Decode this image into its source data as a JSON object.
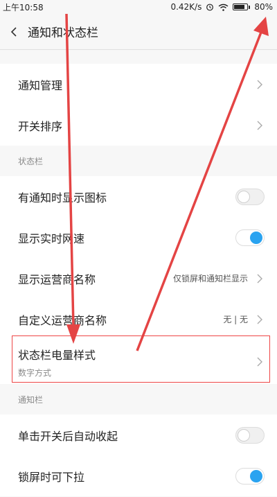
{
  "status_bar": {
    "time": "上午10:58",
    "net_speed": "0.42K/s",
    "battery": "80%",
    "icons": [
      "alarm-icon",
      "wifi-icon",
      "battery-icon"
    ]
  },
  "header": {
    "title": "通知和状态栏"
  },
  "top_items": [
    {
      "label": "通知管理"
    },
    {
      "label": "开关排序"
    }
  ],
  "status_section": {
    "header": "状态栏",
    "items": [
      {
        "label": "有通知时显示图标",
        "toggle": false
      },
      {
        "label": "显示实时网速",
        "toggle": true
      },
      {
        "label": "显示运营商名称",
        "value": "仅锁屏和通知栏显示"
      },
      {
        "label": "自定义运营商名称",
        "value": "无 | 无"
      },
      {
        "label": "状态栏电量样式",
        "sublabel": "数字方式"
      }
    ]
  },
  "notify_section": {
    "header": "通知栏",
    "items": [
      {
        "label": "单击开关后自动收起",
        "toggle": false
      },
      {
        "label": "锁屏时可下拉",
        "toggle": true
      }
    ]
  },
  "colors": {
    "accent": "#2aa3f0",
    "annotation": "#e44444"
  }
}
